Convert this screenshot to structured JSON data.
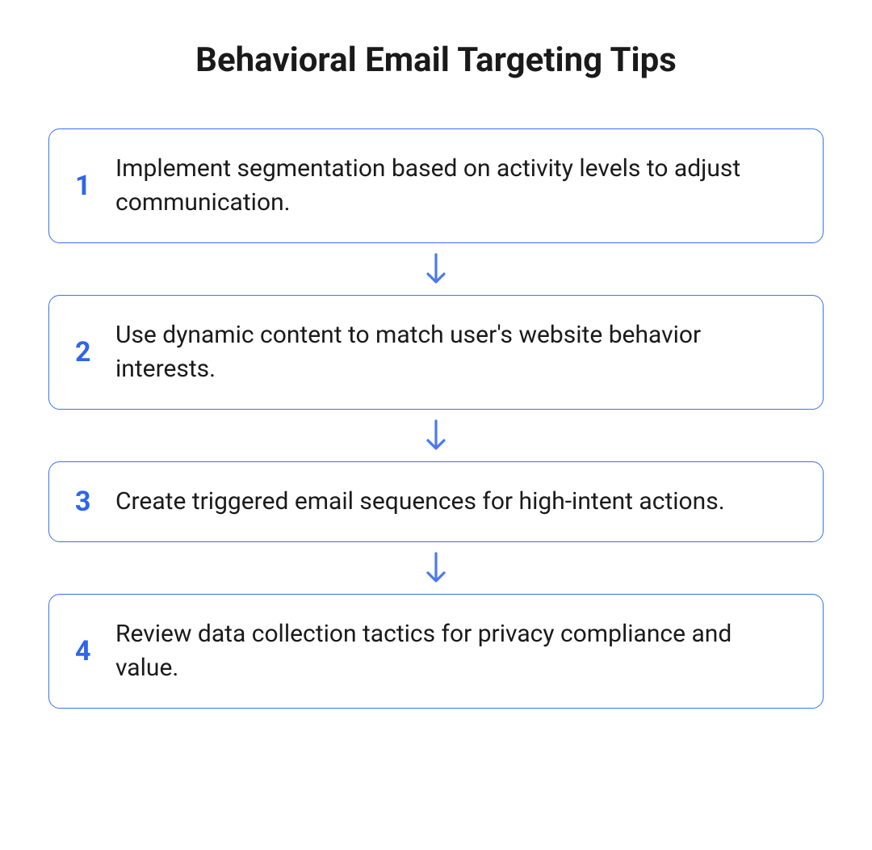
{
  "title": "Behavioral Email Targeting Tips",
  "accent_color": "#2f66e8",
  "steps": [
    {
      "number": "1",
      "text": "Implement segmentation based on activity levels to adjust communication."
    },
    {
      "number": "2",
      "text": "Use dynamic content to match user's website behavior interests."
    },
    {
      "number": "3",
      "text": "Create triggered email sequences for high-intent actions."
    },
    {
      "number": "4",
      "text": "Review data collection tactics for privacy compliance and value."
    }
  ]
}
